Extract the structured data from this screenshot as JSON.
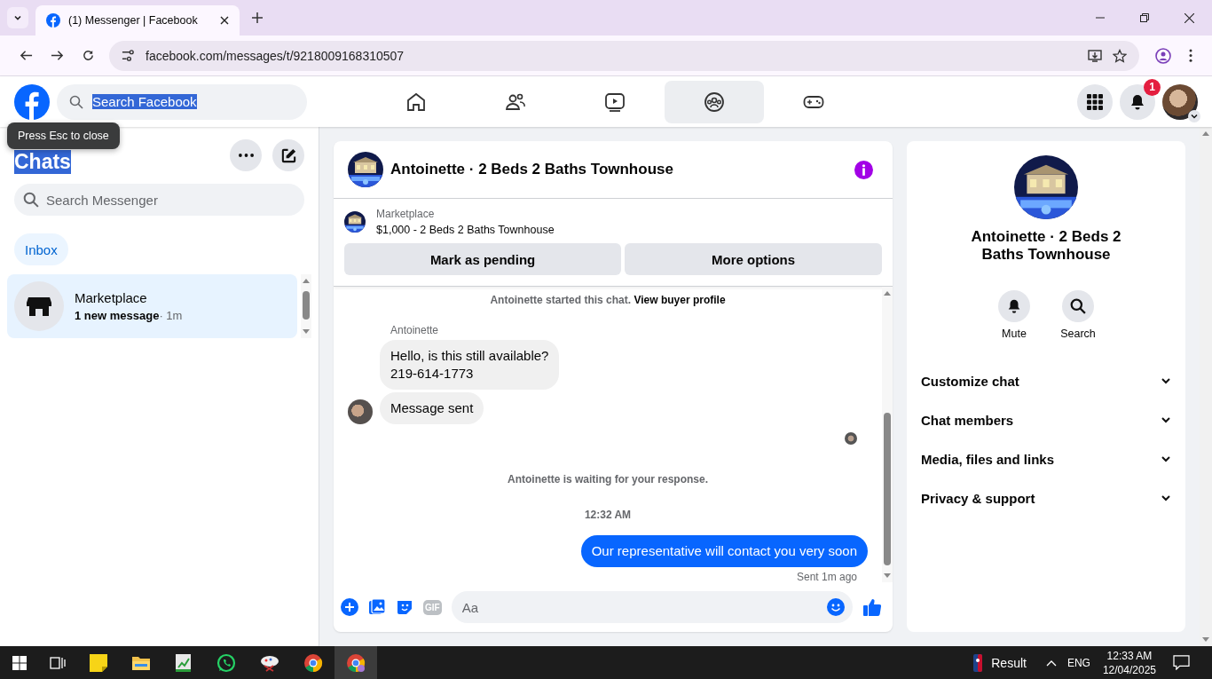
{
  "browser": {
    "tab_title": "(1) Messenger | Facebook",
    "url": "facebook.com/messages/t/9218009168310507"
  },
  "header": {
    "search_value": "Search Facebook",
    "notification_count": "1",
    "nav": [
      {
        "kind": "home",
        "selected": false
      },
      {
        "kind": "friends",
        "selected": false
      },
      {
        "kind": "video",
        "selected": false
      },
      {
        "kind": "groups",
        "selected": true
      },
      {
        "kind": "gaming",
        "selected": false
      }
    ]
  },
  "tooltip": "Press Esc to close",
  "sidebar": {
    "title": "Chats",
    "search_placeholder": "Search Messenger",
    "filters": [
      {
        "label": "Inbox",
        "selected": true
      }
    ],
    "chats": [
      {
        "name": "Marketplace",
        "preview": "1 new message",
        "time": "· 1m",
        "selected": true
      }
    ]
  },
  "conversation": {
    "title": "Antoinette · 2 Beds 2 Baths Townhouse",
    "listing": {
      "category": "Marketplace",
      "title": "$1,000 - 2 Beds 2 Baths Townhouse"
    },
    "actions": [
      "Mark as pending",
      "More options"
    ],
    "messages": [
      {
        "kind": "notice",
        "text": "Antoinette started this chat.",
        "link": "View buyer profile"
      },
      {
        "kind": "name",
        "text": "Antoinette"
      },
      {
        "kind": "incoming",
        "text": "Hello, is this still available?\n219-614-1773",
        "avatar": false
      },
      {
        "kind": "incoming",
        "text": "Message sent",
        "avatar": true
      },
      {
        "kind": "seen"
      },
      {
        "kind": "notice",
        "text": "Antoinette is waiting for your response."
      },
      {
        "kind": "time",
        "text": "12:32 AM"
      },
      {
        "kind": "outgoing",
        "text": "Our representative will contact you very soon"
      },
      {
        "kind": "status",
        "text": "Sent 1m ago"
      }
    ],
    "composer": {
      "placeholder": "Aa",
      "gif_label": "GIF"
    }
  },
  "details": {
    "title": "Antoinette · 2 Beds 2 Baths Townhouse",
    "actions": [
      {
        "kind": "mute",
        "label": "Mute"
      },
      {
        "kind": "search",
        "label": "Search"
      }
    ],
    "sections": [
      {
        "label": "Customize chat",
        "expanded": false
      },
      {
        "label": "Chat members",
        "expanded": false
      },
      {
        "label": "Media, files and links",
        "expanded": false
      },
      {
        "label": "Privacy & support",
        "expanded": false
      }
    ]
  },
  "taskbar": {
    "widget": "Result",
    "language": "ENG",
    "time": "12:33 AM",
    "date": "12/04/2025"
  }
}
